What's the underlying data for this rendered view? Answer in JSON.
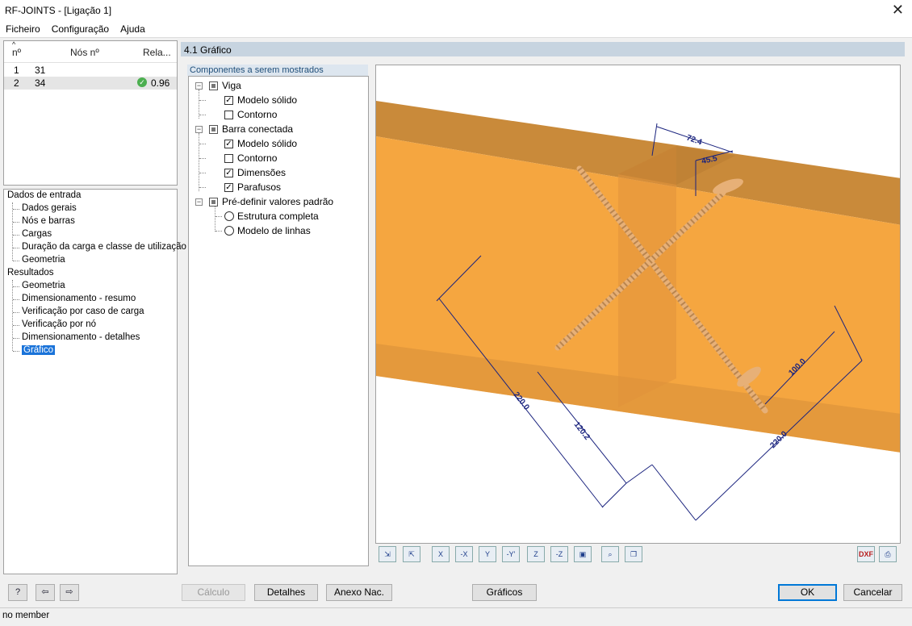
{
  "window": {
    "title": "RF-JOINTS - [Ligação 1]",
    "close_glyph": "✕"
  },
  "menu": [
    "Ficheiro",
    "Configuração",
    "Ajuda"
  ],
  "node_table": {
    "headers": [
      "nº",
      "Nós nº",
      "Rela..."
    ],
    "rows": [
      {
        "n": "1",
        "node": "31",
        "ratio": ""
      },
      {
        "n": "2",
        "node": "34",
        "ratio": "0.96",
        "status_icon": "check-circle-icon",
        "status_color": "#4caf50"
      }
    ]
  },
  "nav": {
    "input_label": "Dados de entrada",
    "input_items": [
      "Dados gerais",
      "Nós e barras",
      "Cargas",
      "Duração da carga e classe de utilização",
      "Geometria"
    ],
    "results_label": "Resultados",
    "results_items": [
      "Geometria",
      "Dimensionamento - resumo",
      "Verificação por caso de carga",
      "Verificação por nó",
      "Dimensionamento - detalhes",
      "Gráfico"
    ],
    "selected": "Gráfico"
  },
  "section_title": "4.1 Gráfico",
  "components": {
    "tab_label": "Componentes a serem mostrados",
    "groups": [
      {
        "label": "Viga",
        "items": [
          {
            "label": "Modelo sólido",
            "checked": true
          },
          {
            "label": "Contorno",
            "checked": false
          }
        ]
      },
      {
        "label": "Barra conectada",
        "items": [
          {
            "label": "Modelo sólido",
            "checked": true
          },
          {
            "label": "Contorno",
            "checked": false
          },
          {
            "label": "Dimensões",
            "checked": true
          },
          {
            "label": "Parafusos",
            "checked": true
          }
        ]
      },
      {
        "label": "Pré-definir valores padrão",
        "radios": [
          {
            "label": "Estrutura completa",
            "selected": false
          },
          {
            "label": "Modelo de linhas",
            "selected": false
          }
        ]
      }
    ]
  },
  "graphic": {
    "dimensions": [
      "72.4",
      "45.5",
      "220.0",
      "120.2",
      "100.0",
      "220.0"
    ],
    "colors": {
      "beam": "#f5a640",
      "beam_dark": "#c98a3a",
      "screw": "#e7b077",
      "dim": "#1a237e"
    }
  },
  "graphic_toolbar": [
    "xz-view-icon",
    "xa-view-icon",
    "view-x-icon",
    "view-neg-x-icon",
    "view-y-icon",
    "view-neg-y-icon",
    "view-z-icon",
    "view-neg-z-icon",
    "iso-view-icon",
    "zoom-icon",
    "copy-icon",
    "dxf-export-icon",
    "print-icon"
  ],
  "toolbar_glyphs": {
    "x": "X",
    "nx": "-X",
    "y": "Y",
    "ny": "-Y'",
    "z": "Z",
    "nz": "-Z",
    "dxf": "DXF"
  },
  "buttons": {
    "calc": "Cálculo",
    "details": "Detalhes",
    "annex": "Anexo Nac.",
    "graphics": "Gráficos",
    "ok": "OK",
    "cancel": "Cancelar"
  },
  "status": "no member"
}
